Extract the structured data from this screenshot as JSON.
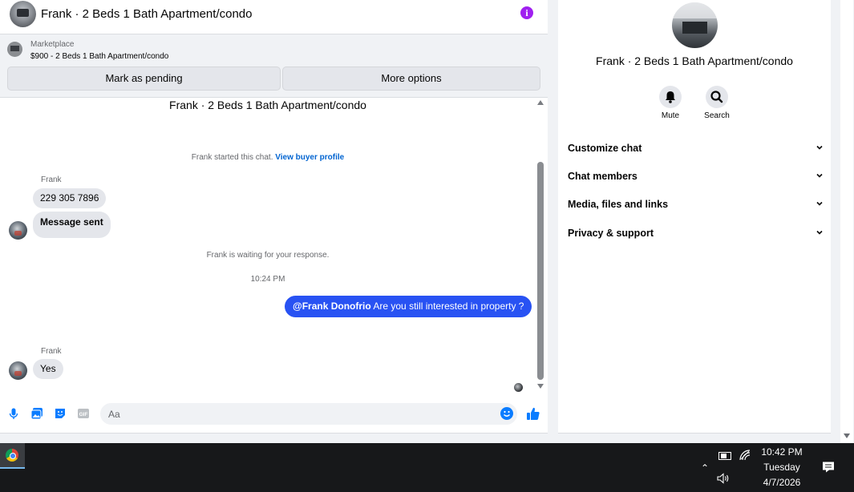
{
  "chat_header": {
    "title": "Frank · 2 Beds 1 Bath Apartment/condo"
  },
  "marketplace": {
    "label": "Marketplace",
    "listing": "$900 - 2 Beds 1 Bath Apartment/condo",
    "mark_pending": "Mark as pending",
    "more_options": "More options"
  },
  "messages": {
    "top_title": "Frank · 2 Beds 1 Bath Apartment/condo",
    "started_text": "Frank started this chat.",
    "view_profile": "View buyer profile",
    "group1_sender": "Frank",
    "msg1": "229 305 7896",
    "msg2": "Message sent",
    "waiting": "Frank is waiting for your response.",
    "timestamp": "10:24 PM",
    "out_mention": "@Frank Donofrio",
    "out_text": " Are you still interested in property ?",
    "group2_sender": "Frank",
    "msg3": "Yes"
  },
  "composer": {
    "placeholder": "Aa"
  },
  "info_panel": {
    "title": "Frank · 2 Beds 1 Bath Apartment/condo",
    "mute": "Mute",
    "search": "Search",
    "sections": [
      "Customize chat",
      "Chat members",
      "Media, files and links",
      "Privacy & support"
    ]
  },
  "taskbar": {
    "time": "10:42 PM",
    "day": "Tuesday",
    "date": "4/7/2026"
  },
  "colors": {
    "accent": "#0a7cff",
    "outgoing_bubble": "#2852f3",
    "info_icon": "#a020f0"
  }
}
